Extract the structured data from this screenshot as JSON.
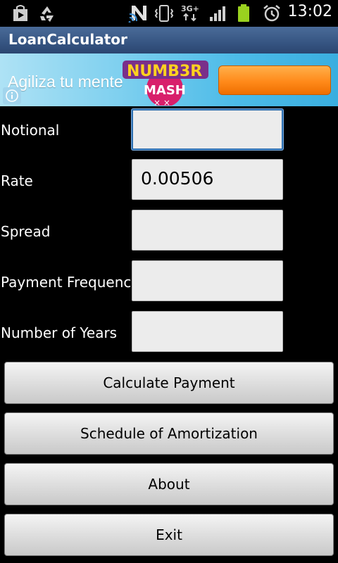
{
  "status_bar": {
    "time": "13:02",
    "icons": [
      "play-store-icon",
      "recycle-icon",
      "nfc-icon",
      "wifi-signal-icon",
      "vibrate-icon",
      "3g-data-icon",
      "signal-bars-icon",
      "battery-icon",
      "alarm-icon"
    ]
  },
  "app": {
    "title": "LoanCalculator"
  },
  "ad": {
    "tagline": "Agiliza tu mente",
    "brand_text": "NUMB3R MASH"
  },
  "form": {
    "fields": [
      {
        "label": "Notional",
        "value": ""
      },
      {
        "label": "Rate",
        "value": "0.00506"
      },
      {
        "label": "Spread",
        "value": ""
      },
      {
        "label": "Payment Frequency",
        "value": ""
      },
      {
        "label": "Number of Years",
        "value": ""
      }
    ]
  },
  "buttons": {
    "calculate": "Calculate Payment",
    "schedule": "Schedule of Amortization",
    "about": "About",
    "exit": "Exit"
  },
  "colors": {
    "title_bar": "#365582",
    "focus_border": "#2e6fb0",
    "ad_button": "#ff8a1a"
  }
}
